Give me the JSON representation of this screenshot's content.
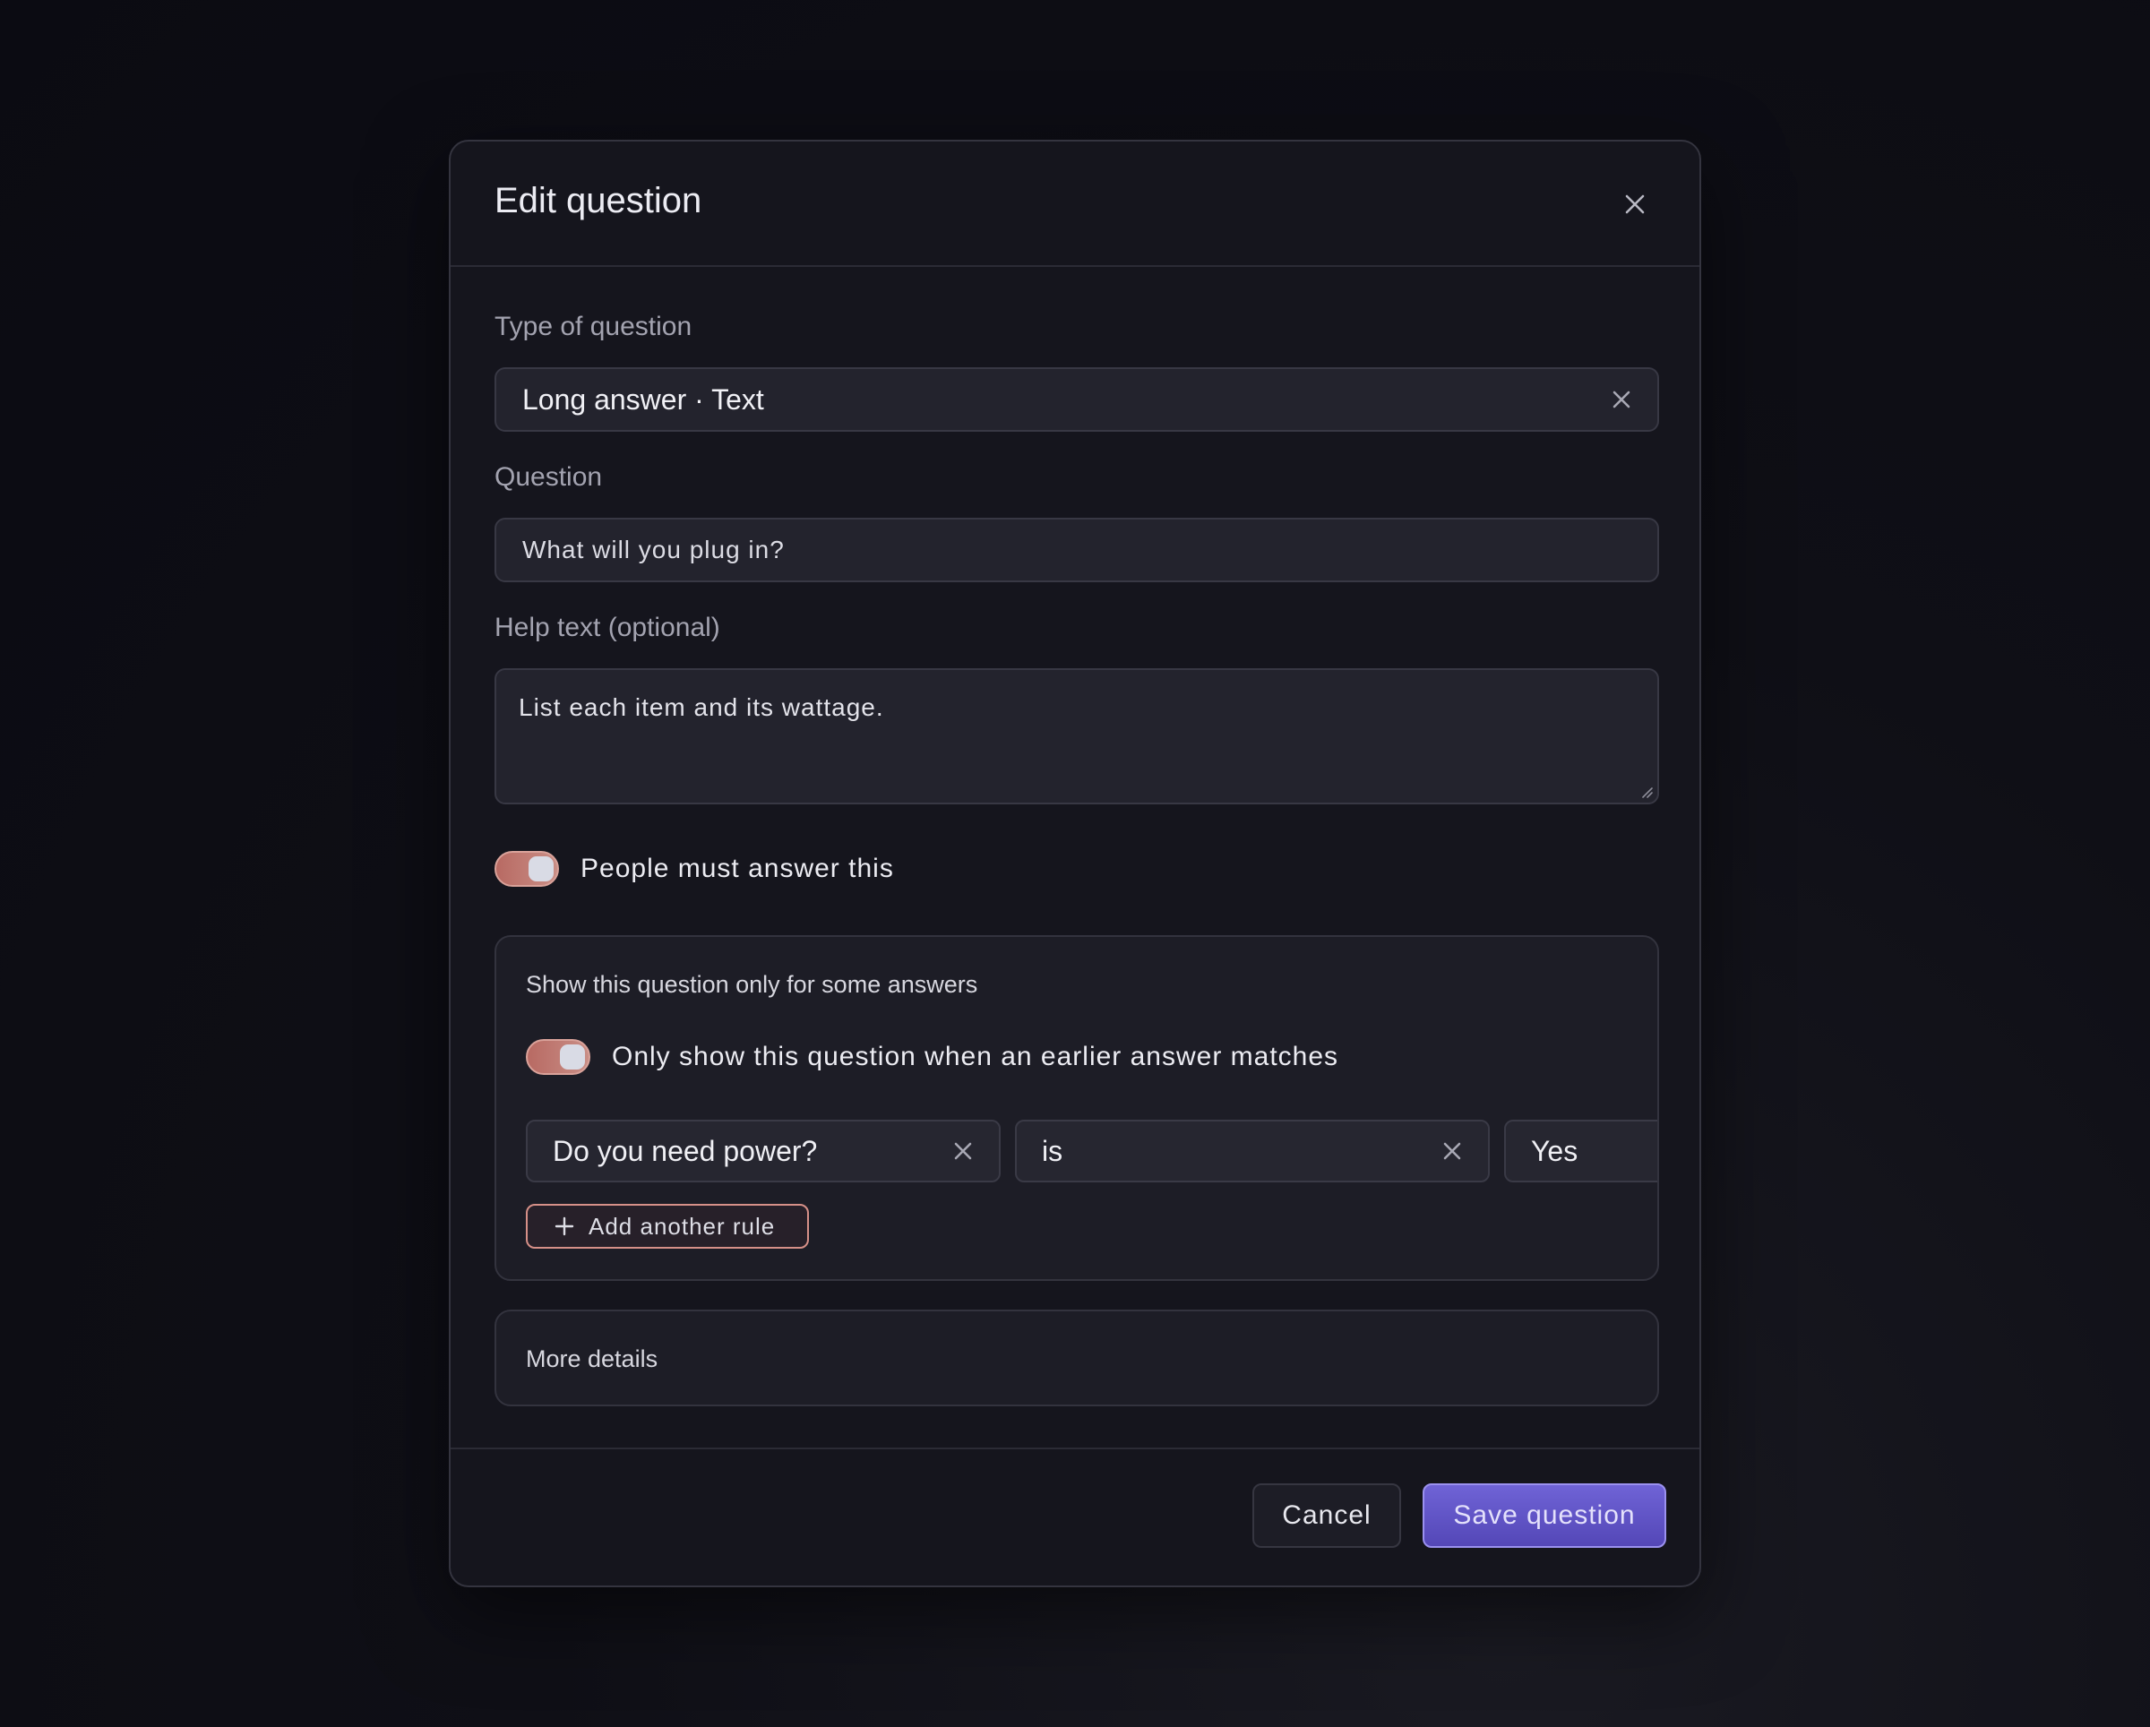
{
  "dialog": {
    "title": "Edit question"
  },
  "fields": {
    "type": {
      "label": "Type of question",
      "value": "Long answer · Text"
    },
    "question": {
      "label": "Question",
      "value": "What will you plug in?"
    },
    "help_text": {
      "label": "Help text (optional)",
      "value": "List each item and its wattage."
    },
    "required": {
      "label": "People must answer this",
      "enabled": true
    }
  },
  "conditions": {
    "title": "Show this question only for some answers",
    "toggle": {
      "label": "Only show this question when an earlier answer matches",
      "enabled": true
    },
    "rule": {
      "question": "Do you need power?",
      "operator": "is",
      "value": "Yes"
    },
    "add_rule_label": "Add another rule"
  },
  "more_details": {
    "title": "More details"
  },
  "footer": {
    "cancel_label": "Cancel",
    "save_label": "Save question"
  },
  "colors": {
    "primary": "#5b4fc4",
    "toggle_on": "#c07a72",
    "background": "#0f0f16",
    "surface": "#15151d"
  }
}
